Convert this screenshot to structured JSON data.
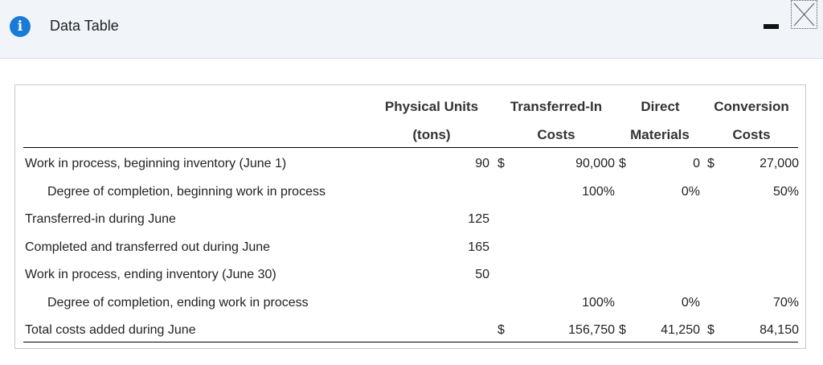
{
  "window": {
    "title": "Data Table",
    "info_icon": "info-icon",
    "minimize_icon": "minimize-icon",
    "close_icon": "close-icon"
  },
  "table": {
    "headers": {
      "physical_units": [
        "Physical Units",
        "(tons)"
      ],
      "transferred_in": [
        "Transferred-In",
        "Costs"
      ],
      "direct_materials": [
        "Direct",
        "Materials"
      ],
      "conversion": [
        "Conversion",
        "Costs"
      ]
    },
    "currency": "$",
    "rows": [
      {
        "label": "Work in process, beginning inventory (June 1)",
        "units": "90",
        "units_cur": "$",
        "ti": "90,000",
        "ti_cur": "$",
        "dm": "0",
        "dm_cur": "$",
        "cc": "27,000"
      },
      {
        "label": "Degree of completion, beginning work in process",
        "units": "",
        "ti": "100%",
        "dm": "0%",
        "cc": "50%"
      },
      {
        "label": "Transferred-in during June",
        "units": "125",
        "ti": "",
        "dm": "",
        "cc": ""
      },
      {
        "label": "Completed and transferred out during June",
        "units": "165",
        "ti": "",
        "dm": "",
        "cc": ""
      },
      {
        "label": "Work in process, ending inventory (June 30)",
        "units": "50",
        "ti": "",
        "dm": "",
        "cc": ""
      },
      {
        "label": "Degree of completion, ending work in process",
        "units": "",
        "ti": "100%",
        "dm": "0%",
        "cc": "70%"
      },
      {
        "label": "Total costs added during June",
        "units": "",
        "units_cur": "$",
        "ti": "156,750",
        "ti_cur": "$",
        "dm": "41,250",
        "dm_cur": "$",
        "cc": "84,150"
      }
    ]
  }
}
